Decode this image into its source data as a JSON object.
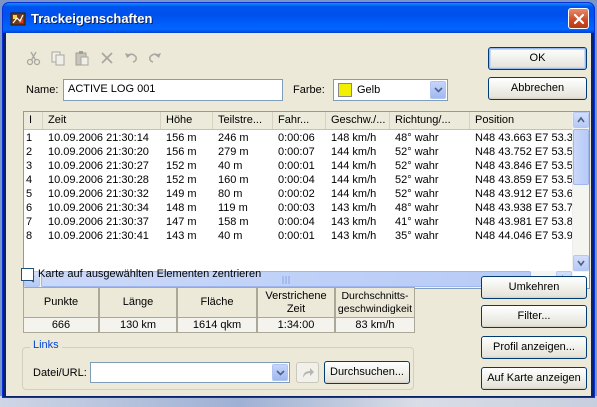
{
  "window": {
    "title": "Trackeigenschaften"
  },
  "toolbar": {
    "icons": [
      "scissors-icon",
      "copy-icon",
      "paste-icon",
      "delete-icon",
      "undo-icon",
      "redo-icon"
    ]
  },
  "form": {
    "name_label": "Name:",
    "name_value": "ACTIVE LOG 001",
    "color_label": "Farbe:",
    "color_value": "Gelb",
    "color_swatch": "#f0f000"
  },
  "buttons": {
    "ok": "OK",
    "cancel": "Abbrechen",
    "reverse": "Umkehren",
    "filter": "Filter...",
    "profile": "Profil anzeigen...",
    "show_on_map": "Auf Karte anzeigen",
    "browse": "Durchsuchen..."
  },
  "table": {
    "columns": [
      "I",
      "Zeit",
      "Höhe",
      "Teilstre...",
      "Fahr...",
      "Geschw./...",
      "Richtung/...",
      "Position"
    ],
    "rows": [
      [
        "1",
        "10.09.2006 21:30:14",
        "156 m",
        "246 m",
        "0:00:06",
        "148 km/h",
        "48° wahr",
        "N48 43.663 E7 53.3"
      ],
      [
        "2",
        "10.09.2006 21:30:20",
        "156 m",
        "279 m",
        "0:00:07",
        "144 km/h",
        "52° wahr",
        "N48 43.752 E7 53.5"
      ],
      [
        "3",
        "10.09.2006 21:30:27",
        "152 m",
        "40 m",
        "0:00:01",
        "144 km/h",
        "52° wahr",
        "N48 43.846 E7 53.5"
      ],
      [
        "4",
        "10.09.2006 21:30:28",
        "152 m",
        "160 m",
        "0:00:04",
        "144 km/h",
        "52° wahr",
        "N48 43.859 E7 53.5"
      ],
      [
        "5",
        "10.09.2006 21:30:32",
        "149 m",
        "80 m",
        "0:00:02",
        "144 km/h",
        "52° wahr",
        "N48 43.912 E7 53.6"
      ],
      [
        "6",
        "10.09.2006 21:30:34",
        "148 m",
        "119 m",
        "0:00:03",
        "143 km/h",
        "48° wahr",
        "N48 43.938 E7 53.7"
      ],
      [
        "7",
        "10.09.2006 21:30:37",
        "147 m",
        "158 m",
        "0:00:04",
        "143 km/h",
        "41° wahr",
        "N48 43.981 E7 53.8"
      ],
      [
        "8",
        "10.09.2006 21:30:41",
        "143 m",
        "40 m",
        "0:00:01",
        "143 km/h",
        "35° wahr",
        "N48 44.046 E7 53.9"
      ]
    ]
  },
  "center_map": {
    "label": "Karte auf ausgewählten Elementen zentrieren",
    "checked": false
  },
  "stats": {
    "headers": [
      "Punkte",
      "Länge",
      "Fläche",
      "Verstrichene Zeit",
      "Durchschnitts-geschwindigkeit"
    ],
    "values": [
      "666",
      "130 km",
      "1614 qkm",
      "1:34:00",
      "83 km/h"
    ]
  },
  "links": {
    "group_title": "Links",
    "url_label": "Datei/URL:",
    "url_value": ""
  }
}
